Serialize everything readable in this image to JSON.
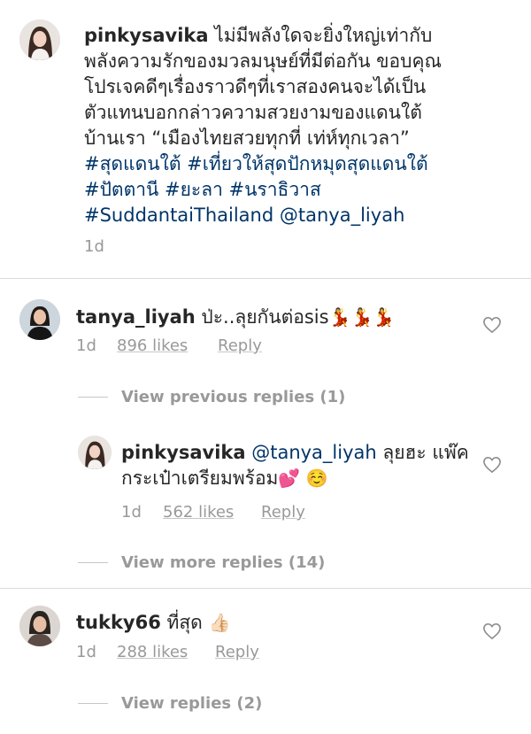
{
  "post": {
    "username": "pinkysavika",
    "caption_lines": [
      " ไม่มีพลังใดจะยิ่งใหญ่เท่ากับ",
      "พลังความรักของมวลมนุษย์ที่มีต่อกัน ขอบคุณ",
      "โปรเจคดีๆเรื่องราวดีๆที่เราสองคนจะได้เป็น",
      "ตัวแทนบอกกล่าวความสวยงามของแดนใต้",
      "บ้านเรา “เมืองไทยสวยทุกที่ เท่ห์ทุกเวลา”"
    ],
    "hashtag_lines": [
      "#สุดแดนใต้ #เที่ยวให้สุดปักหมุดสุดแดนใต้",
      "#ปัตตานี #ยะลา #นราธิวาส"
    ],
    "last_line_tag": "#SuddantaiThailand",
    "last_line_mention": "@tanya_liyah",
    "time": "1d"
  },
  "comments": [
    {
      "username": "tanya_liyah",
      "text": " ป่ะ..ลุยกันต่อsis",
      "emoji": "💃💃💃",
      "time": "1d",
      "likes": "896 likes",
      "reply": "Reply"
    },
    {
      "username": "pinkysavika",
      "mention": "@tanya_liyah",
      "text_line1": " ลุยฮะ แพ๊ค",
      "text_line2": "กระเป๋าเตรียมพร้อม",
      "emoji": "💕 ☺️",
      "time": "1d",
      "likes": "562 likes",
      "reply": "Reply"
    },
    {
      "username": "tukky66",
      "text": " ที่สุด ",
      "emoji": "👍🏻",
      "time": "1d",
      "likes": "288 likes",
      "reply": "Reply"
    }
  ],
  "view_previous": "View previous replies (1)",
  "view_more": "View more replies (14)",
  "view_replies": "View replies (2)",
  "icons": {
    "like": "heart-outline-icon"
  },
  "colors": {
    "hashtag": "#003569",
    "muted": "#999999",
    "text": "#262626"
  }
}
